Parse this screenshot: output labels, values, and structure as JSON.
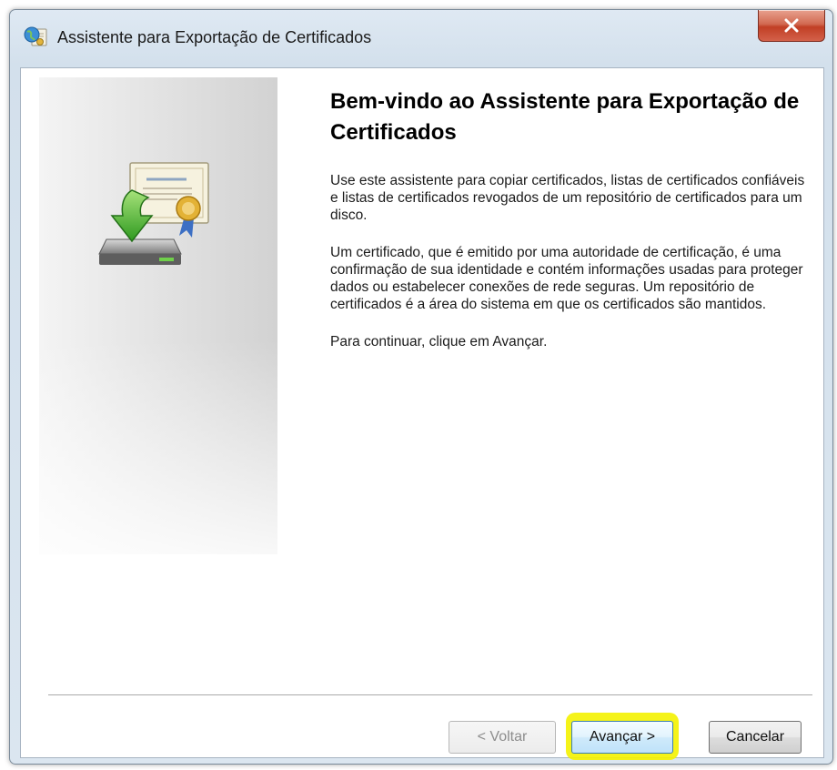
{
  "window": {
    "title": "Assistente para Exportação de Certificados",
    "close_label": "X"
  },
  "main": {
    "heading": "Bem-vindo ao Assistente para Exportação de Certificados",
    "paragraphs": [
      "Use este assistente para copiar certificados, listas de certificados confiáveis e listas de certificados revogados de um repositório de certificados para um disco.",
      "Um certificado, que é emitido por uma autoridade de certificação, é uma confirmação de sua identidade e contém informações usadas para proteger dados ou estabelecer conexões de rede seguras. Um repositório de certificados é a área do sistema em que os certificados são mantidos.",
      "Para continuar, clique em Avançar."
    ]
  },
  "buttons": {
    "back": "< Voltar",
    "next": "Avançar >",
    "cancel": "Cancelar"
  },
  "icons": {
    "title_icon": "certificate-globe-icon",
    "wizard_graphic": "certificate-export-disk-icon",
    "close": "close-icon"
  },
  "colors": {
    "highlight": "#f4f200",
    "close_button": "#c13f25"
  }
}
